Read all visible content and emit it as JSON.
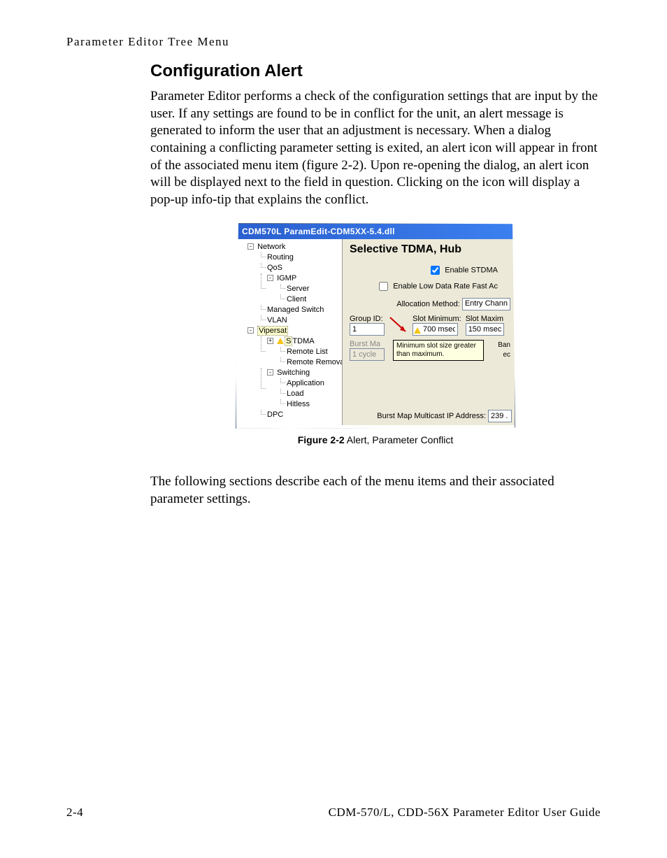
{
  "header": {
    "breadcrumb": "Parameter Editor Tree Menu"
  },
  "section": {
    "heading": "Configuration Alert",
    "para1": "Parameter Editor performs a check of the configuration settings that are input by the user. If any settings are found to be in conflict for the unit, an alert message is generated to inform the user that an adjustment is necessary. When a dialog containing a conflicting parameter setting is exited, an alert icon will appear in front of the associated menu item (figure 2-2). Upon re-opening the dialog, an alert icon will be displayed next to the field in question. Clicking on the icon will display a pop-up info-tip that explains the conflict.",
    "para2": "The following sections describe each of the menu items and their associated parameter settings."
  },
  "figure": {
    "label_bold": "Figure 2-2",
    "label_rest": "   Alert, Parameter Conflict"
  },
  "window": {
    "title": "CDM570L ParamEdit-CDM5XX-5.4.dll",
    "tree": {
      "network": "Network",
      "routing": "Routing",
      "qos": "QoS",
      "igmp": "IGMP",
      "server": "Server",
      "client": "Client",
      "mswitch": "Managed Switch",
      "vlan": "VLAN",
      "vipersat": "Vipersat",
      "stdma": "STDMA",
      "remote_list": "Remote List",
      "remote_removal": "Remote Removal",
      "switching": "Switching",
      "application": "Application",
      "load": "Load",
      "hitless": "Hitless",
      "dpc": "DPC"
    },
    "right": {
      "heading": "Selective TDMA, Hub",
      "enable_stdma": "Enable STDMA",
      "enable_low_data": "Enable Low Data Rate Fast Ac",
      "alloc_method_label": "Allocation Method:",
      "alloc_method_value": "Entry Chann",
      "group_id_label": "Group ID:",
      "group_id_value": "1",
      "slot_min_label": "Slot Minimum:",
      "slot_min_value": "700 msec",
      "slot_max_label": "Slot Maxim",
      "slot_max_value": "150 msec",
      "burst_map_label": "Burst Ma",
      "burst_map_value": "1 cycle",
      "tooltip": "Minimum slot size greater than maximum.",
      "ban": "Ban",
      "ec": "ec",
      "multicast_label": "Burst Map Multicast IP Address:",
      "multicast_value": "239 ."
    }
  },
  "footer": {
    "page_num": "2-4",
    "doc_title": "CDM-570/L, CDD-56X Parameter Editor User Guide"
  }
}
